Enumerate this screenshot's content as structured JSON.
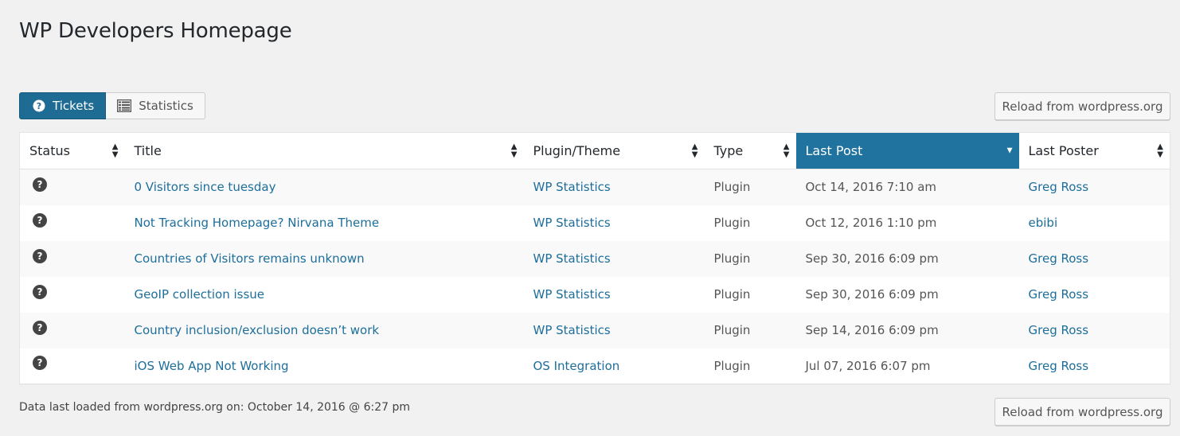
{
  "page": {
    "title": "WP Developers Homepage"
  },
  "tabs": [
    {
      "label": "Tickets",
      "icon": "question-circle-icon",
      "active": true
    },
    {
      "label": "Statistics",
      "icon": "list-table-icon",
      "active": false
    }
  ],
  "reload_label": "Reload from wordpress.org",
  "table": {
    "columns": [
      "Status",
      "Title",
      "Plugin/Theme",
      "Type",
      "Last Post",
      "Last Poster"
    ],
    "sorted_column": "Last Post",
    "rows": [
      {
        "status": "?",
        "title": "0 Visitors since tuesday",
        "plugin": "WP Statistics",
        "type": "Plugin",
        "last_post": "Oct 14, 2016 7:10 am",
        "poster": "Greg Ross"
      },
      {
        "status": "?",
        "title": "Not Tracking Homepage? Nirvana Theme",
        "plugin": "WP Statistics",
        "type": "Plugin",
        "last_post": "Oct 12, 2016 1:10 pm",
        "poster": "ebibi"
      },
      {
        "status": "?",
        "title": "Countries of Visitors remains unknown",
        "plugin": "WP Statistics",
        "type": "Plugin",
        "last_post": "Sep 30, 2016 6:09 pm",
        "poster": "Greg Ross"
      },
      {
        "status": "?",
        "title": "GeoIP collection issue",
        "plugin": "WP Statistics",
        "type": "Plugin",
        "last_post": "Sep 30, 2016 6:09 pm",
        "poster": "Greg Ross"
      },
      {
        "status": "?",
        "title": "Country inclusion/exclusion doesn’t work",
        "plugin": "WP Statistics",
        "type": "Plugin",
        "last_post": "Sep 14, 2016 6:09 pm",
        "poster": "Greg Ross"
      },
      {
        "status": "?",
        "title": "iOS Web App Not Working",
        "plugin": "OS Integration",
        "type": "Plugin",
        "last_post": "Jul 07, 2016 6:07 pm",
        "poster": "Greg Ross"
      }
    ]
  },
  "footer": {
    "text": "Data last loaded from wordpress.org on: October 14, 2016 @ 6:27 pm"
  },
  "colors": {
    "accent": "#21739f",
    "link": "#1d6e9b",
    "background": "#f1f1f1"
  }
}
